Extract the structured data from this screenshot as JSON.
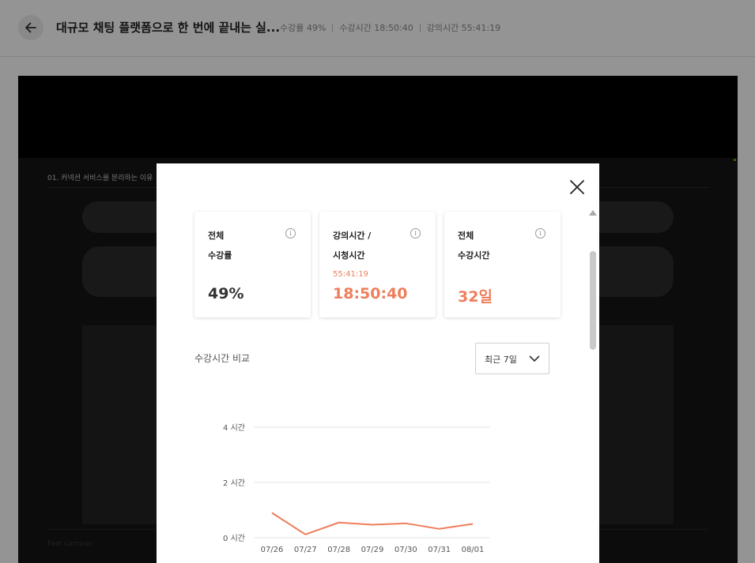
{
  "header": {
    "title": "대규모 채팅 플랫폼으로 한 번에 끝내는 실...",
    "progress": "수강률 49%",
    "study_time": "수강시간 18:50:40",
    "lecture_time": "강의시간 55:41:19"
  },
  "player": {
    "slide_title": "01. 커넥션 서비스를 분리하는 이유",
    "watermark": "Fast campus"
  },
  "modal": {
    "cards": [
      {
        "label1": "전체",
        "label2": "수강률",
        "sub": "",
        "value": "49%",
        "info": "i"
      },
      {
        "label1": "강의시간 /",
        "label2": "시청시간",
        "sub": "55:41:19",
        "value": "18:50:40",
        "info": "i"
      },
      {
        "label1": "전체",
        "label2": "수강시간",
        "sub": "",
        "value": "32일",
        "info": "i"
      }
    ],
    "chart_section_title": "수강시간 비교",
    "period": {
      "selected": "최근 7일"
    },
    "icons": {
      "close": "close-icon",
      "chevron": "chevron-down-icon",
      "info": "info-icon",
      "back": "arrow-left-icon"
    },
    "accent": "#ee7e5c"
  },
  "chart_data": {
    "type": "line",
    "categories": [
      "07/26",
      "07/27",
      "07/28",
      "07/29",
      "07/30",
      "07/31",
      "08/01"
    ],
    "series": [
      {
        "values": [
          0.9,
          0.12,
          0.55,
          0.47,
          0.52,
          0.32,
          0.5
        ]
      }
    ],
    "y_ticks": [
      0,
      2,
      4
    ],
    "y_tick_labels": [
      "0 시간",
      "2 시간",
      "4 시간"
    ],
    "ylim": [
      0,
      4
    ],
    "color": "#ee7e5c",
    "grid": true
  }
}
